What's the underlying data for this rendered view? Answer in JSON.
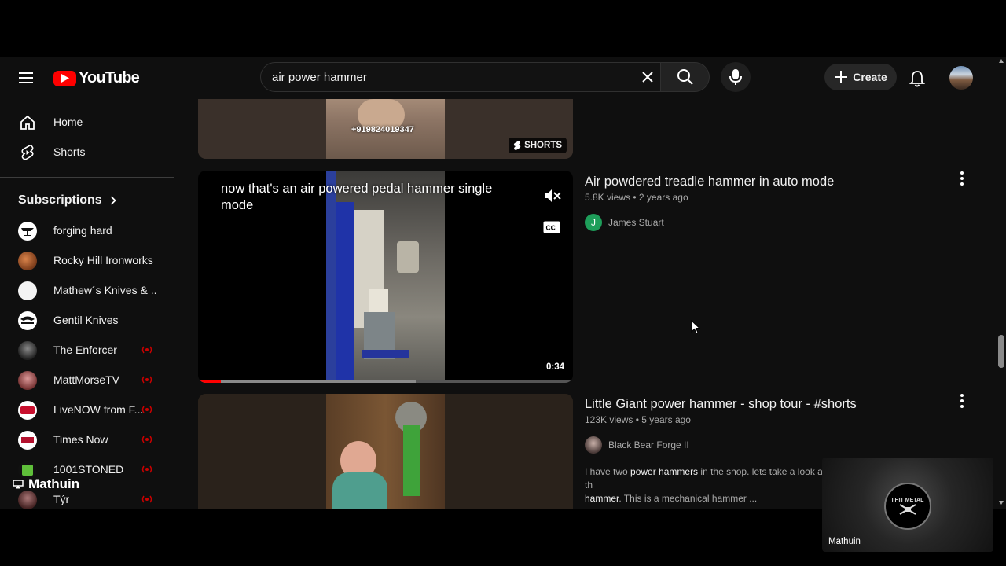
{
  "header": {
    "logo_text": "YouTube",
    "search_value": "air power hammer",
    "create_label": "Create"
  },
  "sidebar": {
    "nav": [
      {
        "label": "Home",
        "icon": "home-icon"
      },
      {
        "label": "Shorts",
        "icon": "shorts-icon"
      }
    ],
    "subscriptions_title": "Subscriptions",
    "subscriptions": [
      {
        "name": "forging hard",
        "live": false
      },
      {
        "name": "Rocky Hill Ironworks",
        "live": false
      },
      {
        "name": "Mathew´s Knives & ...",
        "live": false
      },
      {
        "name": "Gentil Knives",
        "live": false
      },
      {
        "name": "The Enforcer",
        "live": true
      },
      {
        "name": "MattMorseTV",
        "live": true
      },
      {
        "name": "LiveNOW from F...",
        "live": true
      },
      {
        "name": "Times Now",
        "live": true
      },
      {
        "name": "1001STONED",
        "live": true
      },
      {
        "name": "Týr",
        "live": true
      }
    ]
  },
  "results": [
    {
      "phone_overlay": "+919824019347",
      "badge": "SHORTS"
    },
    {
      "title": "Air powdered treadle hammer in auto mode",
      "views": "5.8K views",
      "age": "2 years ago",
      "channel": "James Stuart",
      "channel_initial": "J",
      "caption": "now that's an air powered pedal hammer single mode",
      "duration": "0:34",
      "progress": 0.06,
      "buffered": 0.58
    },
    {
      "title": "Little Giant power hammer - shop tour - #shorts",
      "views": "123K views",
      "age": "5 years ago",
      "channel": "Black Bear Forge II",
      "desc_1": "I have two ",
      "desc_bold_1": "power hammers",
      "desc_2": " in the shop. lets take a look at th",
      "desc_bold_2": "hammer",
      "desc_3": ". This is a mechanical hammer ..."
    }
  ],
  "overlay": {
    "streamer_name": "Mathuin",
    "webcam_name": "Mathuin",
    "webcam_logo_text": "I HIT METAL"
  },
  "colors": {
    "background": "#0f0f0f",
    "accent_red": "#ff0000",
    "text": "#f1f1f1",
    "secondary_text": "#aaaaaa"
  }
}
